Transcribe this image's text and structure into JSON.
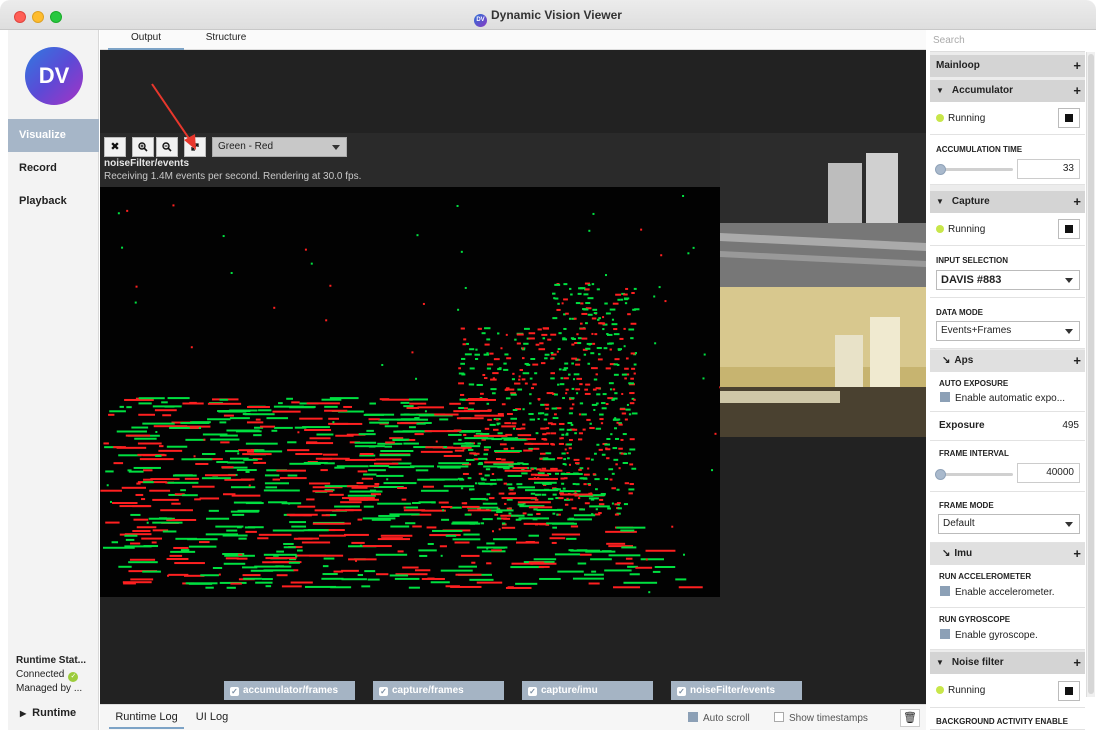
{
  "window": {
    "title": "Dynamic Vision Viewer",
    "icon": "dv-app-icon"
  },
  "sidebar": {
    "logo_text": "DV",
    "items": [
      {
        "label": "Visualize",
        "active": true
      },
      {
        "label": "Record",
        "active": false
      },
      {
        "label": "Playback",
        "active": false
      }
    ],
    "runtime_status": {
      "title": "Runtime Stat...",
      "connected": "Connected",
      "managed": "Managed by ..."
    },
    "runtime_label": "Runtime"
  },
  "main": {
    "tabs": [
      {
        "label": "Output",
        "active": true
      },
      {
        "label": "Structure",
        "active": false
      }
    ],
    "viewer": {
      "color_mode": "Green - Red",
      "stream_name": "noiseFilter/events",
      "info": "Receiving 1.4M events per second. Rendering at 30.0 fps."
    },
    "streams": [
      "accumulator/frames",
      "capture/frames",
      "capture/imu",
      "noiseFilter/events"
    ]
  },
  "log": {
    "tabs": [
      {
        "label": "Runtime Log",
        "active": true
      },
      {
        "label": "UI Log",
        "active": false
      }
    ],
    "auto_scroll": "Auto scroll",
    "show_timestamps": "Show timestamps"
  },
  "panel": {
    "search_placeholder": "Search",
    "mainloop": "Mainloop",
    "accumulator": {
      "title": "Accumulator",
      "status": "Running",
      "accum_time_label": "ACCUMULATION TIME",
      "accum_time_value": "33",
      "accum_slider_fraction": 0.0
    },
    "capture": {
      "title": "Capture",
      "status": "Running",
      "input_label": "INPUT SELECTION",
      "input_value": "DAVIS #883",
      "data_mode_label": "DATA MODE",
      "data_mode_value": "Events+Frames"
    },
    "aps": {
      "title": "Aps",
      "auto_exp_label": "AUTO EXPOSURE",
      "auto_exp_text": "Enable automatic expo...",
      "exposure_label": "Exposure",
      "exposure_value": "495",
      "frame_interval_label": "FRAME INTERVAL",
      "frame_interval_value": "40000",
      "frame_interval_fraction": 0.0,
      "frame_mode_label": "FRAME MODE",
      "frame_mode_value": "Default"
    },
    "imu": {
      "title": "Imu",
      "accel_label": "RUN ACCELEROMETER",
      "accel_text": "Enable accelerometer.",
      "gyro_label": "RUN GYROSCOPE",
      "gyro_text": "Enable gyroscope."
    },
    "noise_filter": {
      "title": "Noise filter",
      "status": "Running",
      "bg_label": "BACKGROUND ACTIVITY ENABLE"
    }
  },
  "colors": {
    "sidebar_active": "#a6b6c8",
    "running_dot": "#c8e64a",
    "event_on": "#00e040",
    "event_off": "#ff2020",
    "annotation_arrow": "#e8372c"
  }
}
